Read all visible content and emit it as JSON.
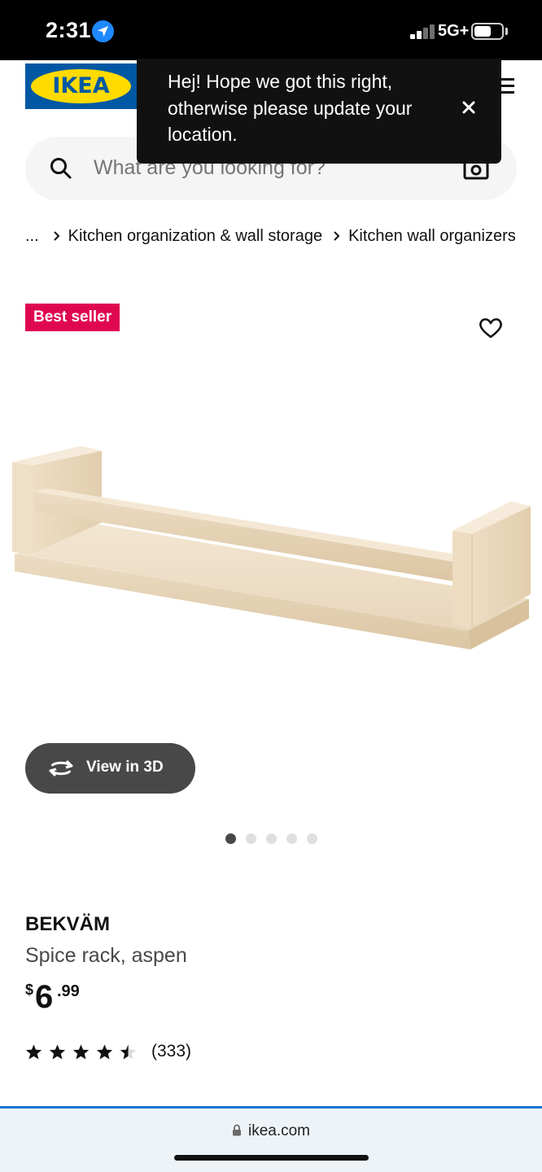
{
  "status_bar": {
    "time": "2:31",
    "network": "5G+"
  },
  "header": {
    "logo_text": "IKEA",
    "search_placeholder": "What are you looking for?"
  },
  "toast": {
    "message": "Hej! Hope we got this right, otherwise please update your location."
  },
  "breadcrumb": {
    "ellipsis": "...",
    "items": [
      "Kitchen organization & wall storage",
      "Kitchen wall organizers"
    ]
  },
  "badge": "Best seller",
  "view_3d_label": "View in 3D",
  "carousel": {
    "total": 5,
    "active": 1
  },
  "product": {
    "name": "BEKVÄM",
    "description": "Spice rack, aspen",
    "price_currency": "$",
    "price_integer": "6",
    "price_decimal": ".99",
    "rating_stars": 4.5,
    "review_count": "(333)"
  },
  "browser": {
    "url": "ikea.com"
  },
  "colors": {
    "ikea_blue": "#0058a3",
    "ikea_yellow": "#ffdb00",
    "badge_red": "#e00751",
    "dark_button": "#484848"
  }
}
